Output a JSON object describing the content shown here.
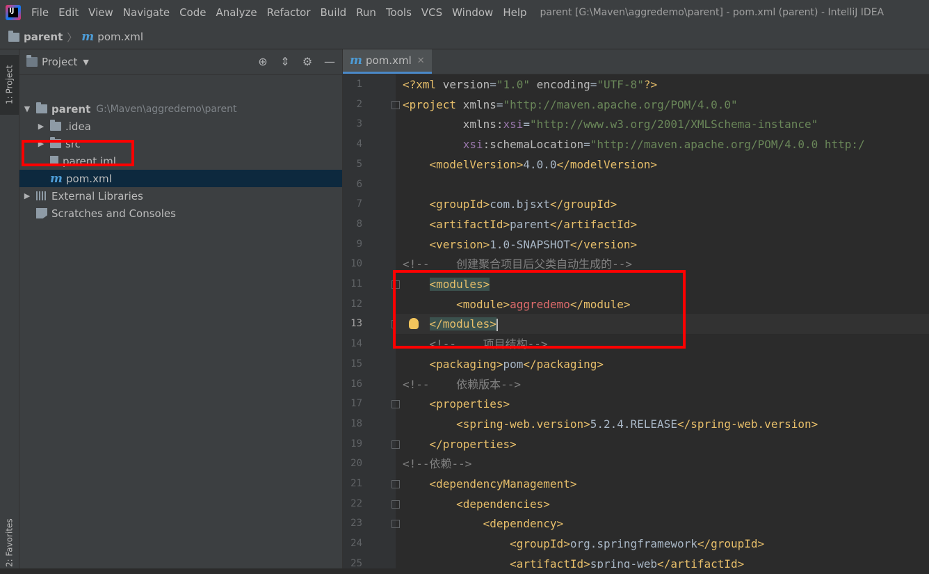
{
  "menubar": {
    "items": [
      "File",
      "Edit",
      "View",
      "Navigate",
      "Code",
      "Analyze",
      "Refactor",
      "Build",
      "Run",
      "Tools",
      "VCS",
      "Window",
      "Help"
    ],
    "window_title": "parent [G:\\Maven\\aggredemo\\parent] - pom.xml (parent) - IntelliJ IDEA"
  },
  "navbar": {
    "root": "parent",
    "file": "pom.xml"
  },
  "sidebar": {
    "project_tab": "1: Project",
    "favorites_tab": "2: Favorites"
  },
  "project_panel": {
    "title": "Project",
    "tree": [
      {
        "label": "parent",
        "path": "G:\\Maven\\aggredemo\\parent",
        "type": "folder",
        "expanded": true
      },
      {
        "label": ".idea",
        "type": "folder"
      },
      {
        "label": "src",
        "type": "folder"
      },
      {
        "label": "parent.iml",
        "type": "file"
      },
      {
        "label": "pom.xml",
        "type": "maven",
        "selected": true
      },
      {
        "label": "External Libraries",
        "type": "library"
      },
      {
        "label": "Scratches and Consoles",
        "type": "scratch"
      }
    ]
  },
  "editor": {
    "tab_label": "pom.xml",
    "current_line": 13,
    "lines": [
      {
        "n": "1",
        "tokens": [
          [
            "tag",
            "<?xml "
          ],
          [
            "attr",
            "version"
          ],
          [
            "text",
            "="
          ],
          [
            "val",
            "\"1.0\""
          ],
          [
            "attr",
            " encoding"
          ],
          [
            "text",
            "="
          ],
          [
            "val",
            "\"UTF-8\""
          ],
          [
            "tag",
            "?>"
          ]
        ]
      },
      {
        "n": "2",
        "tokens": [
          [
            "tag",
            "<project "
          ],
          [
            "attr",
            "xmlns"
          ],
          [
            "text",
            "="
          ],
          [
            "val",
            "\"http://maven.apache.org/POM/4.0.0\""
          ]
        ]
      },
      {
        "n": "3",
        "tokens": [
          [
            "text",
            "         "
          ],
          [
            "attr",
            "xmlns:"
          ],
          [
            "ns",
            "xsi"
          ],
          [
            "text",
            "="
          ],
          [
            "val",
            "\"http://www.w3.org/2001/XMLSchema-instance\""
          ]
        ]
      },
      {
        "n": "4",
        "tokens": [
          [
            "text",
            "         "
          ],
          [
            "ns",
            "xsi"
          ],
          [
            "attr",
            ":schemaLocation"
          ],
          [
            "text",
            "="
          ],
          [
            "val",
            "\"http://maven.apache.org/POM/4.0.0 http:/"
          ]
        ]
      },
      {
        "n": "5",
        "tokens": [
          [
            "text",
            "    "
          ],
          [
            "tag",
            "<modelVersion>"
          ],
          [
            "text",
            "4.0.0"
          ],
          [
            "tag",
            "</modelVersion>"
          ]
        ]
      },
      {
        "n": "6",
        "tokens": []
      },
      {
        "n": "7",
        "tokens": [
          [
            "text",
            "    "
          ],
          [
            "tag",
            "<groupId>"
          ],
          [
            "text",
            "com.bjsxt"
          ],
          [
            "tag",
            "</groupId>"
          ]
        ]
      },
      {
        "n": "8",
        "tokens": [
          [
            "text",
            "    "
          ],
          [
            "tag",
            "<artifactId>"
          ],
          [
            "text",
            "parent"
          ],
          [
            "tag",
            "</artifactId>"
          ]
        ]
      },
      {
        "n": "9",
        "tokens": [
          [
            "text",
            "    "
          ],
          [
            "tag",
            "<version>"
          ],
          [
            "text",
            "1.0-SNAPSHOT"
          ],
          [
            "tag",
            "</version>"
          ]
        ]
      },
      {
        "n": "10",
        "tokens": [
          [
            "cm",
            "<!--    创建聚合项目后父类自动生成的-->"
          ]
        ]
      },
      {
        "n": "11",
        "tokens": [
          [
            "text",
            "    "
          ],
          [
            "tag hl",
            "<modules>"
          ]
        ]
      },
      {
        "n": "12",
        "tokens": [
          [
            "text",
            "        "
          ],
          [
            "tag",
            "<module>"
          ],
          [
            "red",
            "aggredemo"
          ],
          [
            "tag",
            "</module>"
          ]
        ]
      },
      {
        "n": "13",
        "tokens": [
          [
            "text",
            "    "
          ],
          [
            "tag hl",
            "</modules>"
          ]
        ]
      },
      {
        "n": "14",
        "tokens": [
          [
            "cm",
            "    <!--    项目结构-->"
          ]
        ]
      },
      {
        "n": "15",
        "tokens": [
          [
            "text",
            "    "
          ],
          [
            "tag",
            "<packaging>"
          ],
          [
            "text",
            "pom"
          ],
          [
            "tag",
            "</packaging>"
          ]
        ]
      },
      {
        "n": "16",
        "tokens": [
          [
            "cm",
            "<!--    依赖版本-->"
          ]
        ]
      },
      {
        "n": "17",
        "tokens": [
          [
            "text",
            "    "
          ],
          [
            "tag",
            "<properties>"
          ]
        ]
      },
      {
        "n": "18",
        "tokens": [
          [
            "text",
            "        "
          ],
          [
            "tag",
            "<spring-web.version>"
          ],
          [
            "text",
            "5.2.4.RELEASE"
          ],
          [
            "tag",
            "</spring-web.version>"
          ]
        ]
      },
      {
        "n": "19",
        "tokens": [
          [
            "text",
            "    "
          ],
          [
            "tag",
            "</properties>"
          ]
        ]
      },
      {
        "n": "20",
        "tokens": [
          [
            "cm",
            "<!--依赖-->"
          ]
        ]
      },
      {
        "n": "21",
        "tokens": [
          [
            "text",
            "    "
          ],
          [
            "tag",
            "<dependencyManagement>"
          ]
        ]
      },
      {
        "n": "22",
        "tokens": [
          [
            "text",
            "        "
          ],
          [
            "tag",
            "<dependencies>"
          ]
        ]
      },
      {
        "n": "23",
        "tokens": [
          [
            "text",
            "            "
          ],
          [
            "tag",
            "<dependency>"
          ]
        ]
      },
      {
        "n": "24",
        "tokens": [
          [
            "text",
            "                "
          ],
          [
            "tag",
            "<groupId>"
          ],
          [
            "text",
            "org.springframework"
          ],
          [
            "tag",
            "</groupId>"
          ]
        ]
      },
      {
        "n": "25",
        "tokens": [
          [
            "text",
            "                "
          ],
          [
            "tag",
            "<artifactId>"
          ],
          [
            "text",
            "spring-web"
          ],
          [
            "tag",
            "</artifactId>"
          ]
        ]
      }
    ],
    "fold_lines": [
      "2",
      "11",
      "13",
      "17",
      "19",
      "21",
      "22",
      "23"
    ]
  },
  "colors": {
    "selection": "#0d293e",
    "accent": "#4a88c7",
    "annotation": "#ff0000"
  }
}
